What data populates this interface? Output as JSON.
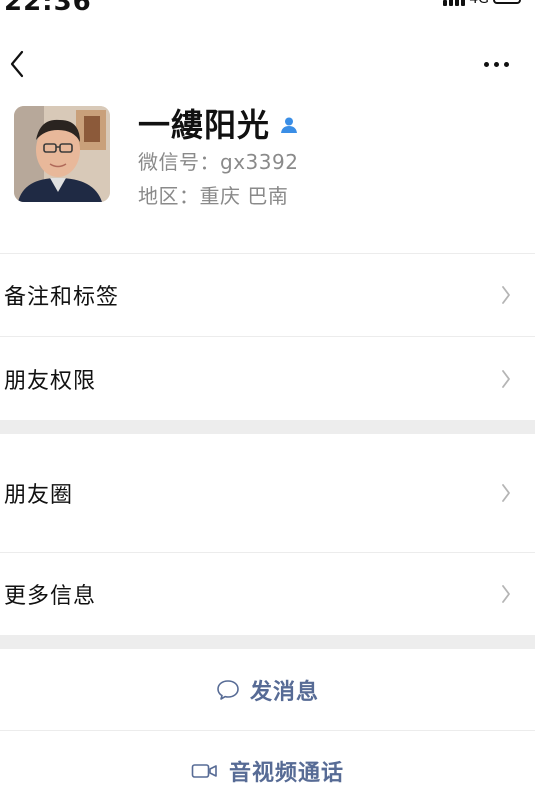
{
  "status_bar": {
    "time": "22:36",
    "network": "4G"
  },
  "profile": {
    "name": "一縷阳光",
    "wechat_id": "微信号：gx3392",
    "region": "地区：重庆 巴南"
  },
  "menu": {
    "remarks_tags": "备注和标签",
    "friend_permissions": "朋友权限",
    "moments": "朋友圈",
    "more_info": "更多信息"
  },
  "actions": {
    "send_message": "发消息",
    "video_call": "音视频通话"
  },
  "colors": {
    "link_blue": "#576b95",
    "verified_blue": "#3a8ee6",
    "secondary_text": "#8a8a8a",
    "separator_band": "#ededed"
  }
}
